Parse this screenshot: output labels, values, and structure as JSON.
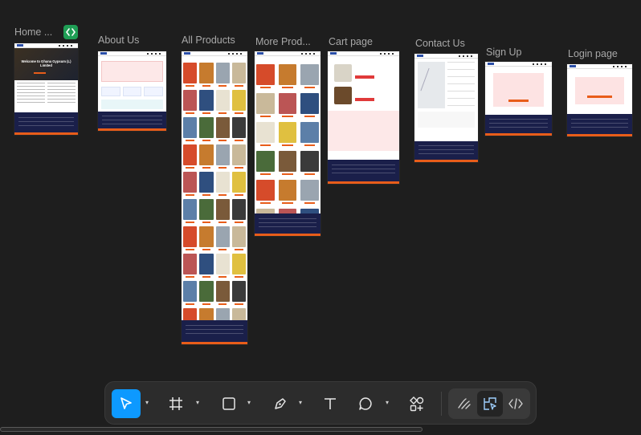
{
  "canvas": {
    "background": "#1e1e1e",
    "frames": [
      {
        "label": "Home ..."
      },
      {
        "label": "About Us"
      },
      {
        "label": "All Products"
      },
      {
        "label": "More Prod..."
      },
      {
        "label": "Cart page"
      },
      {
        "label": "Contact Us"
      },
      {
        "label": "Sign Up"
      },
      {
        "label": "Login page"
      }
    ],
    "home_hero_text": "Welcome to Ghana Gypsum (L) Limited"
  },
  "toolbar": {
    "tools": [
      {
        "icon": "move-cursor-icon",
        "active": true,
        "has_menu": true
      },
      {
        "icon": "frame-icon",
        "has_menu": true
      },
      {
        "icon": "rectangle-icon",
        "has_menu": true
      },
      {
        "icon": "pen-icon",
        "has_menu": true
      },
      {
        "icon": "text-icon",
        "has_menu": false
      },
      {
        "icon": "comment-icon",
        "has_menu": true
      },
      {
        "icon": "actions-icon",
        "has_menu": false
      }
    ],
    "modes": [
      {
        "icon": "draw-mode-icon"
      },
      {
        "icon": "design-mode-icon",
        "active": true
      },
      {
        "icon": "dev-mode-icon"
      }
    ]
  },
  "colors": {
    "accent": "#0d99ff",
    "brand_orange": "#e85d1a",
    "footer_navy": "#1a1f4a",
    "dev_badge": "#1f9e55"
  }
}
